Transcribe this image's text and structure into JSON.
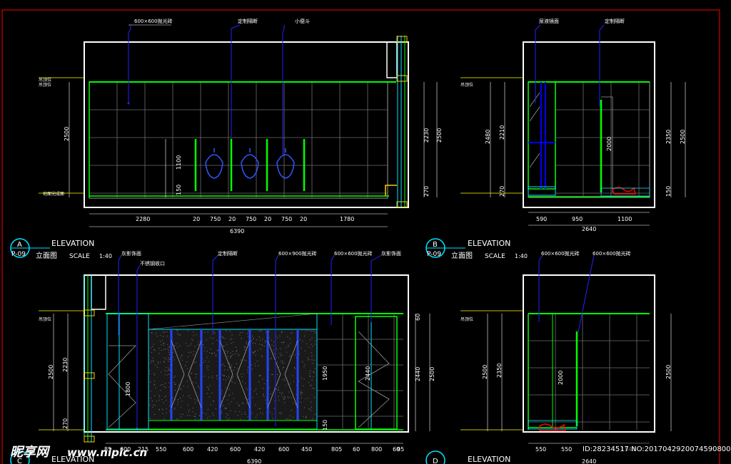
{
  "drawing": {
    "views": [
      {
        "id": "A",
        "sheet": "P-09",
        "title_en": "ELEVATION",
        "title_cn": "立面图",
        "scale_label": "SCALE",
        "scale": "1:40",
        "annotations": [
          "600×600抛光砖",
          "定制隔断",
          "小便斗"
        ],
        "levels": {
          "ceiling": "吊顶位",
          "floor": "地面完成面"
        },
        "h_dims": [
          "2280",
          "20",
          "750",
          "20",
          "750",
          "20",
          "750",
          "20",
          "1780"
        ],
        "h_total": "6390",
        "v_dims_left": [
          "2500",
          "1100",
          "150"
        ],
        "v_dims_right": [
          "2230",
          "270",
          "2500"
        ]
      },
      {
        "id": "B",
        "sheet": "P-09",
        "title_en": "ELEVATION",
        "title_cn": "立面图",
        "scale_label": "SCALE",
        "scale": "1:40",
        "annotations": [
          "尿液镜面",
          "定制隔断"
        ],
        "levels": {
          "ceiling": "吊顶位"
        },
        "h_dims": [
          "590",
          "950",
          "1100"
        ],
        "h_total": "2640",
        "v_dims_left": [
          "2480",
          "2210",
          "270"
        ],
        "v_dims_mid": [
          "2000"
        ],
        "v_dims_right": [
          "2350",
          "2500",
          "150"
        ]
      },
      {
        "id": "C",
        "title_en": "ELEVATION",
        "annotations": [
          "灰影饰面",
          "不锈钢收口",
          "定制隔断",
          "600×900抛光砖",
          "600×600抛光砖",
          "灰影饰面"
        ],
        "levels": {
          "ceiling": "吊顶位"
        },
        "h_dims": [
          "85",
          "600",
          "215",
          "550",
          "600",
          "420",
          "600",
          "420",
          "600",
          "450",
          "805",
          "60",
          "800",
          "60",
          "95"
        ],
        "h_total": "6390",
        "v_dims_left": [
          "2500",
          "2230",
          "270",
          "1800"
        ],
        "v_dims_mid": [
          "1950",
          "2440",
          "150"
        ],
        "v_dims_right": [
          "60",
          "2440",
          "2500"
        ]
      },
      {
        "id": "D",
        "title_en": "ELEVATION",
        "annotations": [
          "600×600抛光砖",
          "600×600抛光砖"
        ],
        "levels": {
          "ceiling": "吊顶位"
        },
        "h_dims": [
          "550",
          "550",
          "1540"
        ],
        "h_total": "2640",
        "v_dims_left": [
          "2500",
          "2350"
        ],
        "v_dims_mid": [
          "2000"
        ],
        "v_dims_right": [
          "2500"
        ]
      }
    ]
  },
  "watermark": {
    "brand": "昵享网",
    "url": "www.nipic.cn",
    "id": "ID:28234517 NO:20170429200745908000"
  },
  "colors": {
    "background": "#000000",
    "frame": "#ffffff",
    "grid": "#8a8a8a",
    "wall": "#00ff00",
    "partition": "#0000ff",
    "dim": "#ffffff",
    "level": "#ffff00",
    "cyan": "#00e5ff",
    "red": "#ff0000",
    "border": "#ff0000"
  }
}
